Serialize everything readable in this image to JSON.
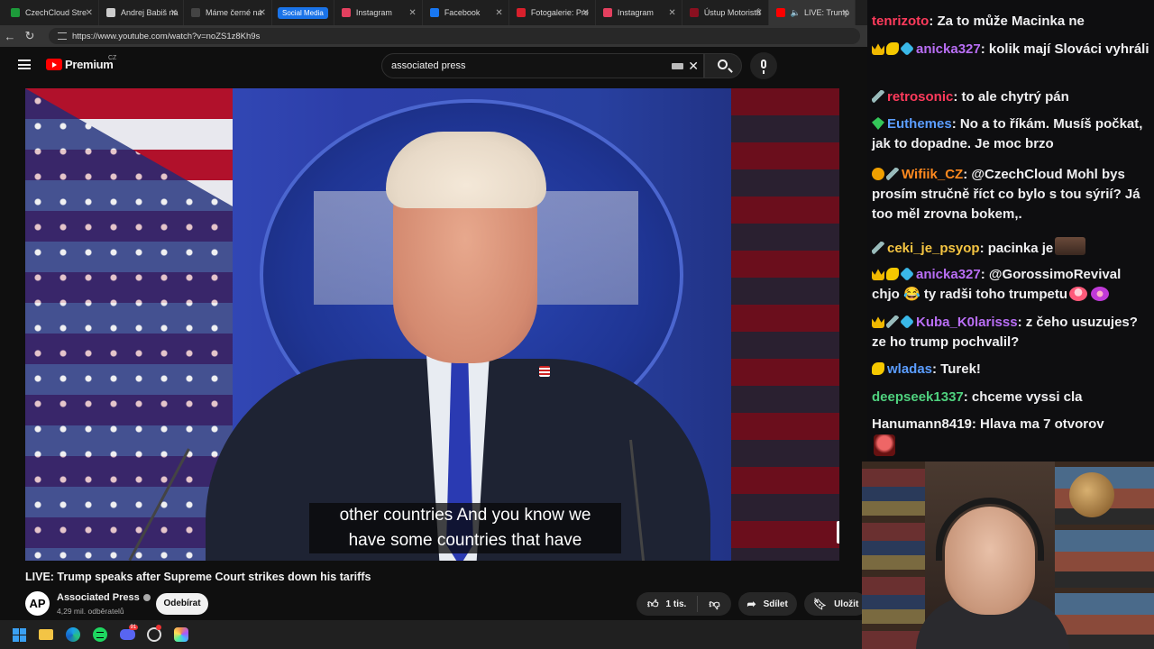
{
  "browser": {
    "tabs": [
      {
        "title": "CzechCloud Stre",
        "favicon_color": "#1d9a3a",
        "active": false
      },
      {
        "title": "Andrej Babiš na",
        "favicon_color": "#cccccc",
        "active": false
      },
      {
        "title": "Máme černé na",
        "favicon_color": "#444444",
        "favicon_text": "SZ",
        "active": false
      },
      {
        "title": "Social Media",
        "group": true
      },
      {
        "title": "Instagram",
        "favicon_color": "#e4405f",
        "active": false
      },
      {
        "title": "Facebook",
        "favicon_color": "#1877f2",
        "active": false
      },
      {
        "title": "Fotogalerie: Pre",
        "favicon_color": "#d8202c",
        "active": false
      },
      {
        "title": "Instagram",
        "favicon_color": "#e4405f",
        "active": false
      },
      {
        "title": "Ústup Motoristů",
        "favicon_color": "#8a1020",
        "active": false
      },
      {
        "title": "LIVE: Trump",
        "favicon_color": "#ff0000",
        "active": true
      }
    ],
    "url": "https://www.youtube.com/watch?v=noZS1z8Kh9s"
  },
  "youtube": {
    "logo_text": "Premium",
    "country_code": "CZ",
    "search_query": "associated press",
    "video": {
      "caption_line1": "other countries And you know we",
      "caption_line2": "have some countries that have",
      "watermark": "AP"
    },
    "title": "LIVE: Trump speaks after Supreme Court strikes down his tariffs",
    "channel": {
      "avatar_text": "AP",
      "name": "Associated Press",
      "subscribers": "4,29 mil. odběratelů",
      "subscribe_label": "Odebírat"
    },
    "actions": {
      "likes": "1 tis.",
      "share_label": "Sdílet",
      "save_label": "Uložit"
    }
  },
  "taskbar": {
    "apps": [
      "windows-start",
      "file-explorer",
      "edge",
      "spotify",
      "discord",
      "obs",
      "copilot"
    ],
    "discord_badge": "91"
  },
  "chat": {
    "messages": [
      {
        "user": "tenrizoto",
        "color": "#ff3b5c",
        "badges": [],
        "text": "Za to může Macinka ne"
      },
      {
        "user": "anicka327",
        "color": "#b96ef5",
        "badges": [
          "crown",
          "hand",
          "cube"
        ],
        "text": "kolik mají Slováci vyhráli"
      },
      {
        "user": "retrosonic",
        "color": "#ff3b5c",
        "badges": [
          "sword"
        ],
        "text": "to ale chytrý pán"
      },
      {
        "user": "Euthemes",
        "color": "#5b9dff",
        "badges": [
          "gem"
        ],
        "text": "No a to říkám. Musíš počkat, jak to dopadne. Je moc brzo"
      },
      {
        "user": "Wifiik_CZ",
        "color": "#ff8a1f",
        "badges": [
          "gold",
          "sword"
        ],
        "text": "@CzechCloud Mohl bys prosím stručně říct co bylo s tou sýrií? Já too měl zrovna bokem,."
      },
      {
        "user": "ceki_je_psyop",
        "color": "#f5c542",
        "badges": [
          "sword"
        ],
        "text": "pacinka je"
      },
      {
        "user": "anicka327",
        "color": "#b96ef5",
        "badges": [
          "crown",
          "hand",
          "cube"
        ],
        "text": "@GorossimoRevival chjo 😂 ty radši toho trumpetu"
      },
      {
        "user": "Kuba_K0larisss",
        "color": "#b96ef5",
        "badges": [
          "crown",
          "sword",
          "cube"
        ],
        "text": "z čeho usuzujes? ze ho trump pochvalil?"
      },
      {
        "user": "wladas",
        "color": "#5b9dff",
        "badges": [
          "hand"
        ],
        "text": "Turek!"
      },
      {
        "user": "deepseek1337",
        "color": "#4fd17e",
        "badges": [],
        "text": "chceme vyssi cla"
      },
      {
        "user": "Hanumann8419",
        "color": "#f1f1f1",
        "badges": [],
        "text": "Hlava ma 7 otvorov"
      }
    ]
  }
}
